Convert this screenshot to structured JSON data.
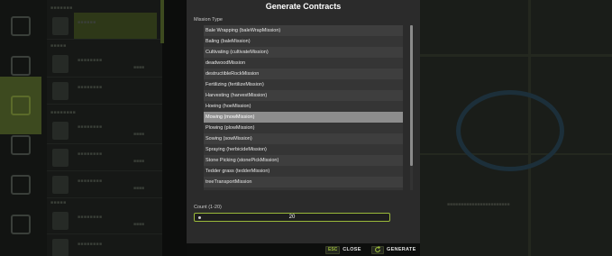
{
  "dialog": {
    "title": "Generate Contracts",
    "mission_type_label": "Mission Type",
    "missions": [
      "Bale Wrapping (baleWrapMission)",
      "Baling (baleMission)",
      "Cultivating (cultivateMission)",
      "deadwoodMission",
      "destructibleRockMission",
      "Fertilizing (fertilizeMission)",
      "Harvesting (harvestMission)",
      "Hoeing (hoeMission)",
      "Mowing (mowMission)",
      "Plowing (plowMission)",
      "Sowing (sowMission)",
      "Spraying (herbicideMission)",
      "Stone Picking (stonePickMission)",
      "Tedder grass (tedderMission)",
      "treeTransportMission"
    ],
    "selected_mission": "Mowing (mowMission)",
    "count_label": "Count (1-20)",
    "count_value": "20"
  },
  "buttons": {
    "close_key": "ESC",
    "close_label": "CLOSE",
    "generate_label": "GENERATE",
    "generate_icon": "refresh-icon"
  },
  "colors": {
    "accent": "#9ab93a",
    "selected_row": "#8d8d8d",
    "dialog_bg": "#2b2b2b"
  }
}
